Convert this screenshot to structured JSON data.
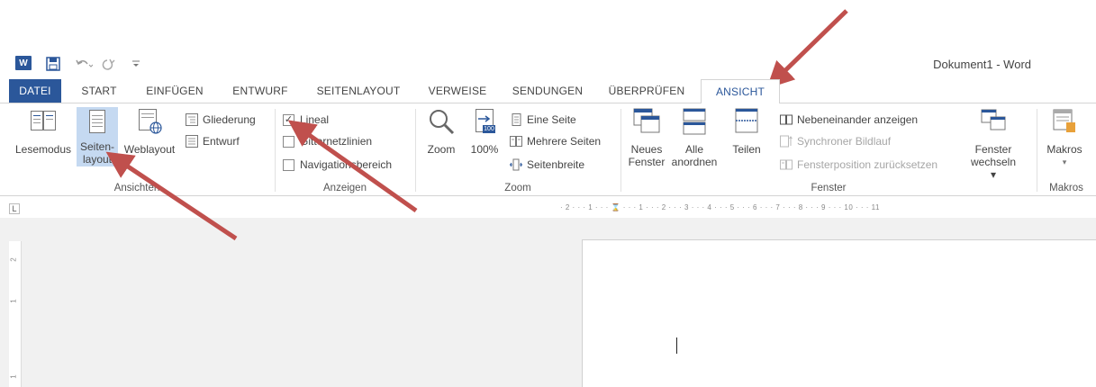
{
  "app": {
    "doc_title": "Dokument1 - Word"
  },
  "quick_access": {
    "word_logo_letter": "W",
    "icons": [
      "word-logo",
      "save-icon",
      "undo-icon",
      "redo-icon",
      "customize-icon"
    ]
  },
  "tabs": [
    "DATEI",
    "START",
    "EINFÜGEN",
    "ENTWURF",
    "SEITENLAYOUT",
    "VERWEISE",
    "SENDUNGEN",
    "ÜBERPRÜFEN",
    "ANSICHT"
  ],
  "active_tab": "ANSICHT",
  "ribbon": {
    "ansichten": {
      "label": "Ansichten",
      "lesemodus": "Lesemodus",
      "seitenlayout_1": "Seiten-",
      "seitenlayout_2": "layout",
      "weblayout": "Weblayout",
      "gliederung": "Gliederung",
      "entwurf": "Entwurf"
    },
    "anzeigen": {
      "label": "Anzeigen",
      "lineal": "Lineal",
      "lineal_checked": true,
      "gitternetzlinien": "Gitternetzlinien",
      "gitternetzlinien_checked": false,
      "navigationsbereich": "Navigationsbereich",
      "navigationsbereich_checked": false
    },
    "zoom": {
      "label": "Zoom",
      "zoom": "Zoom",
      "hundred": "100%",
      "hundred_badge": "100",
      "eine_seite": "Eine Seite",
      "mehrere_seiten": "Mehrere Seiten",
      "seitenbreite": "Seitenbreite"
    },
    "fenster": {
      "label": "Fenster",
      "neues_1": "Neues",
      "neues_2": "Fenster",
      "alle_1": "Alle",
      "alle_2": "anordnen",
      "teilen": "Teilen",
      "nebeneinander": "Nebeneinander anzeigen",
      "synchroner": "Synchroner Bildlauf",
      "fensterposition": "Fensterposition zurücksetzen",
      "wechseln_1": "Fenster",
      "wechseln_2": "wechseln ▾"
    },
    "makros": {
      "label": "Makros",
      "makros": "Makros",
      "dropdown": "▾"
    }
  },
  "ruler": {
    "corner": "L",
    "horizontal": "· 2 · · · 1 · · · ⌛ · · · 1 · · · 2 · · · 3 · · · 4 · · · 5 · · · 6 · · · 7 · · · 8 · · · 9 · · · 10 · · · 11",
    "vertical": [
      "2",
      "1",
      "1"
    ]
  },
  "colors": {
    "accent": "#2b579a",
    "arrow": "#c0504d",
    "selected": "#c5d9f1"
  }
}
